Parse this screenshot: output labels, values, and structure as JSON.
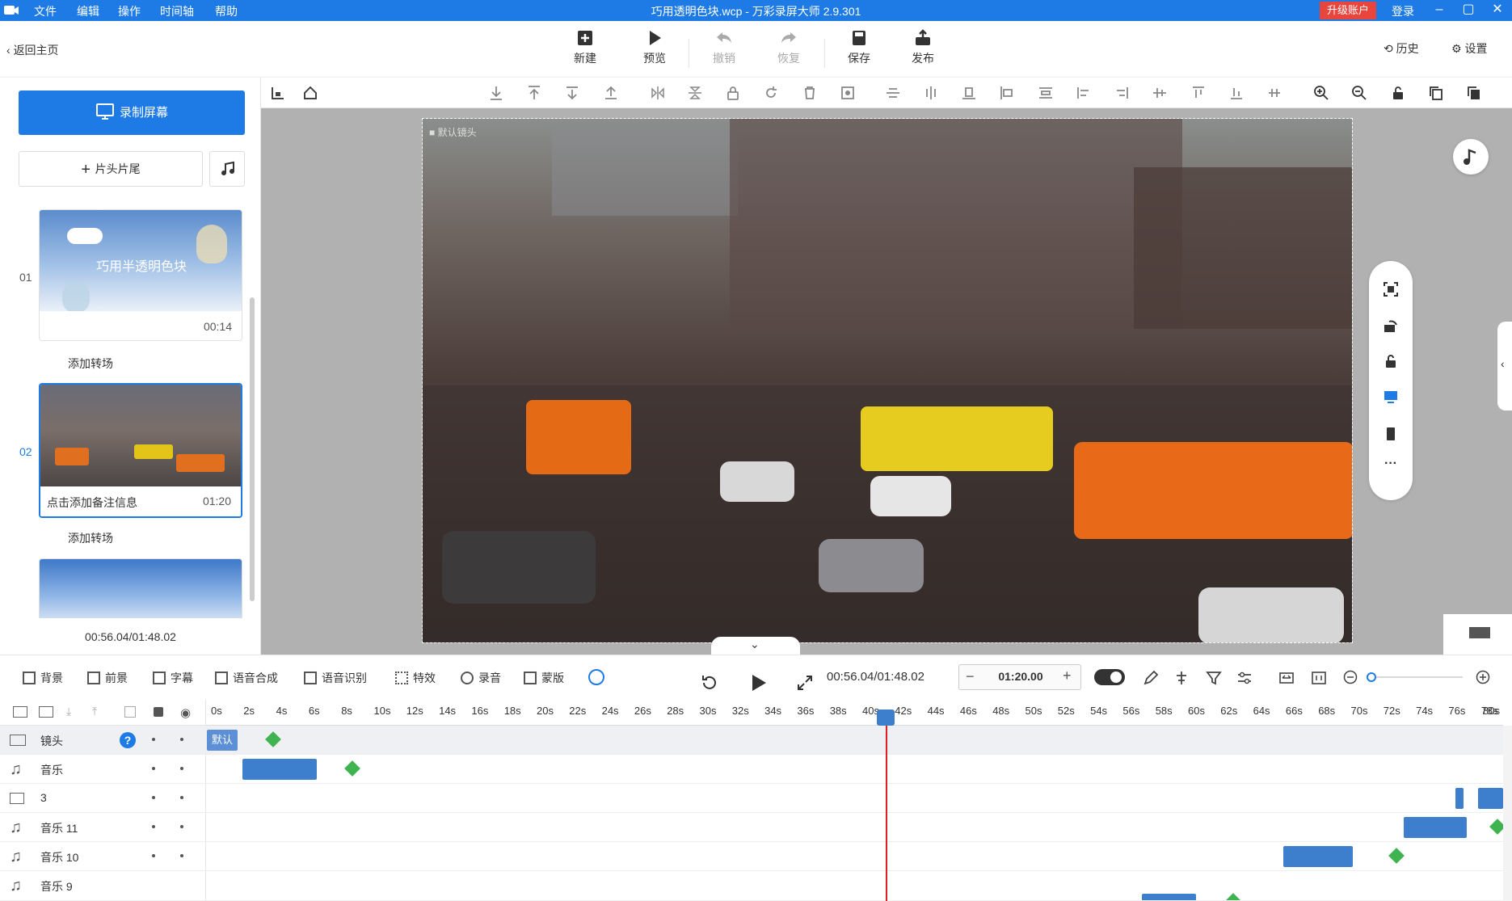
{
  "window": {
    "title": "巧用透明色块.wcp - 万彩录屏大师 2.9.301",
    "menu": [
      "文件",
      "编辑",
      "操作",
      "时间轴",
      "帮助"
    ],
    "upgrade_label": "升级账户",
    "login_label": "登录",
    "accent_color": "#1e7be6"
  },
  "topbar": {
    "back_label": "返回主页",
    "buttons": [
      {
        "label": "新建",
        "icon": "plus-square-icon",
        "enabled": true
      },
      {
        "label": "预览",
        "icon": "play-icon",
        "enabled": true
      },
      {
        "label": "撤销",
        "icon": "undo-icon",
        "enabled": false
      },
      {
        "label": "恢复",
        "icon": "redo-icon",
        "enabled": false
      },
      {
        "label": "保存",
        "icon": "save-icon",
        "enabled": true
      },
      {
        "label": "发布",
        "icon": "publish-icon",
        "enabled": true
      }
    ],
    "history_label": "历史",
    "settings_label": "设置"
  },
  "sidebar": {
    "record_label": "录制屏幕",
    "head_tail_label": "片头片尾",
    "scenes": [
      {
        "number": "01",
        "caption": "巧用半透明色块",
        "duration": "00:14",
        "note": ""
      },
      {
        "number": "02",
        "caption": "",
        "duration": "01:20",
        "note": "点击添加备注信息"
      }
    ],
    "transition_label": "添加转场",
    "total_time": "00:56.04/01:48.02"
  },
  "canvas": {
    "camera_label": "默认镜头"
  },
  "timeline_toolbar": {
    "items": [
      "背景",
      "前景",
      "字幕",
      "语音合成",
      "语音识别",
      "特效",
      "录音",
      "蒙版"
    ],
    "timecode": "00:56.04/01:48.02",
    "duration_value": "01:20.00",
    "minus_label": "−",
    "plus_label": "+"
  },
  "timeline": {
    "ruler": [
      "0s",
      "2s",
      "4s",
      "6s",
      "8s",
      "10s",
      "12s",
      "14s",
      "16s",
      "18s",
      "20s",
      "22s",
      "24s",
      "26s",
      "28s",
      "30s",
      "32s",
      "34s",
      "36s",
      "38s",
      "40s",
      "42s",
      "44s",
      "46s",
      "48s",
      "50s",
      "52s",
      "54s",
      "56s",
      "58s",
      "60s",
      "62s",
      "64s",
      "66s",
      "68s",
      "70s",
      "72s",
      "74s",
      "76s",
      "78s",
      "80s"
    ],
    "camera_chip": "默认",
    "tracks": [
      {
        "name": "镜头",
        "icon": "camera-icon"
      },
      {
        "name": "音乐",
        "icon": "music-note-icon"
      },
      {
        "name": "3",
        "icon": "image-icon"
      },
      {
        "name": "音乐 11",
        "icon": "music-note-icon"
      },
      {
        "name": "音乐 10",
        "icon": "music-note-icon"
      },
      {
        "name": "音乐 9",
        "icon": "music-note-icon"
      }
    ],
    "help_glyph": "?"
  }
}
